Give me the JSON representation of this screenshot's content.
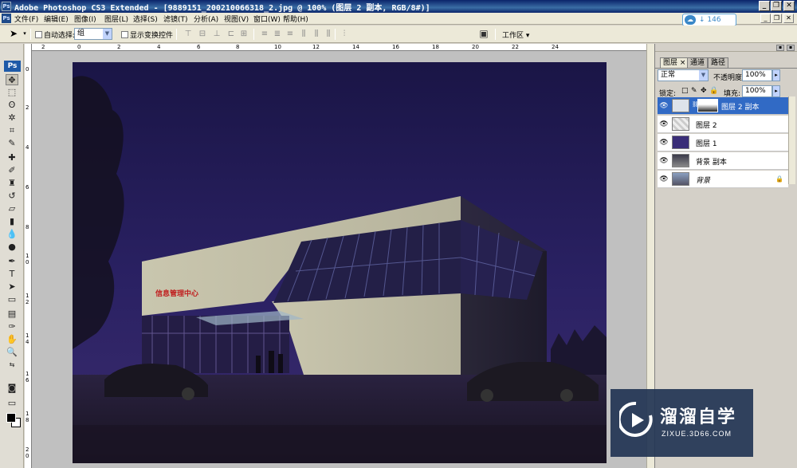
{
  "window": {
    "app_icon": "Ps",
    "title": "Adobe Photoshop CS3 Extended - [9889151_200210066318_2.jpg @ 100% (图层 2 副本, RGB/8#)]",
    "buttons": {
      "minimize": "_",
      "restore": "❐",
      "close": "✕"
    }
  },
  "menu": {
    "items": [
      "文件(F)",
      "编辑(E)",
      "图像(I)",
      "图层(L)",
      "选择(S)",
      "滤镜(T)",
      "分析(A)",
      "视图(V)",
      "窗口(W)",
      "帮助(H)"
    ]
  },
  "network": {
    "speed": "146 KB/s"
  },
  "options": {
    "auto_select_label": "自动选择:",
    "auto_select_value": "组",
    "show_transform_label": "显示变换控件",
    "workspace_label": "工作区"
  },
  "rulers": {
    "h": [
      "2",
      "0",
      "2",
      "4",
      "6",
      "8",
      "10",
      "12",
      "14",
      "16",
      "18",
      "20",
      "22",
      "24"
    ],
    "v": [
      "0",
      "2",
      "4",
      "6",
      "8",
      "1 0",
      "1 2",
      "1 4",
      "1 6",
      "1 8",
      "2 0",
      "2 2"
    ]
  },
  "toolbox": {
    "logo": "Ps"
  },
  "image": {
    "building_sign": "信息管理中心"
  },
  "panel": {
    "tabs": [
      "图层 ×",
      "通道",
      "路径"
    ],
    "blend_mode": "正常",
    "opacity_label": "不透明度:",
    "opacity_value": "100%",
    "lock_label": "锁定:",
    "fill_label": "填充:",
    "fill_value": "100%",
    "layers": [
      {
        "name": "图层 2 副本",
        "active": true
      },
      {
        "name": "图层 2",
        "active": false
      },
      {
        "name": "图层 1",
        "active": false
      },
      {
        "name": "背景 副本",
        "active": false
      },
      {
        "name": "背景",
        "active": false
      }
    ]
  },
  "watermark": {
    "title": "溜溜自学",
    "url": "ZIXUE.3D66.COM"
  }
}
